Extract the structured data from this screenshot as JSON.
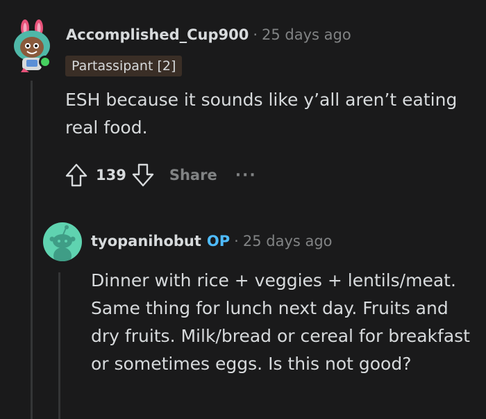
{
  "comment": {
    "username": "Accomplished_Cup900",
    "separator": "·",
    "time": "25 days ago",
    "flair": "Partassipant [2]",
    "body": "ESH because it sounds like y’all aren’t eating real food.",
    "votes": "139",
    "share_label": "Share",
    "more_label": "···",
    "icons": {
      "avatar": "snoo-avatar-bunny-ears",
      "online": "online-status-dot",
      "upvote": "upvote-arrow-icon",
      "downvote": "downvote-arrow-icon"
    }
  },
  "reply": {
    "username": "tyopanihobut",
    "op_badge": "OP",
    "separator": "·",
    "time": "25 days ago",
    "body": "Dinner with rice + veggies + lentils/meat. Same thing for lunch next day. Fruits and dry fruits. Milk/bread or cereal for breakfast or sometimes eggs. Is this not good?",
    "icons": {
      "avatar": "default-snoo-avatar"
    }
  },
  "colors": {
    "background": "#1a1a1b",
    "text": "#d7dadc",
    "muted": "#818384",
    "op_blue": "#4fbcff",
    "online_green": "#46d160",
    "flair_bg": "#3a2e26",
    "avatar2_bg": "#5fd3b0",
    "thread_line": "#343536"
  }
}
